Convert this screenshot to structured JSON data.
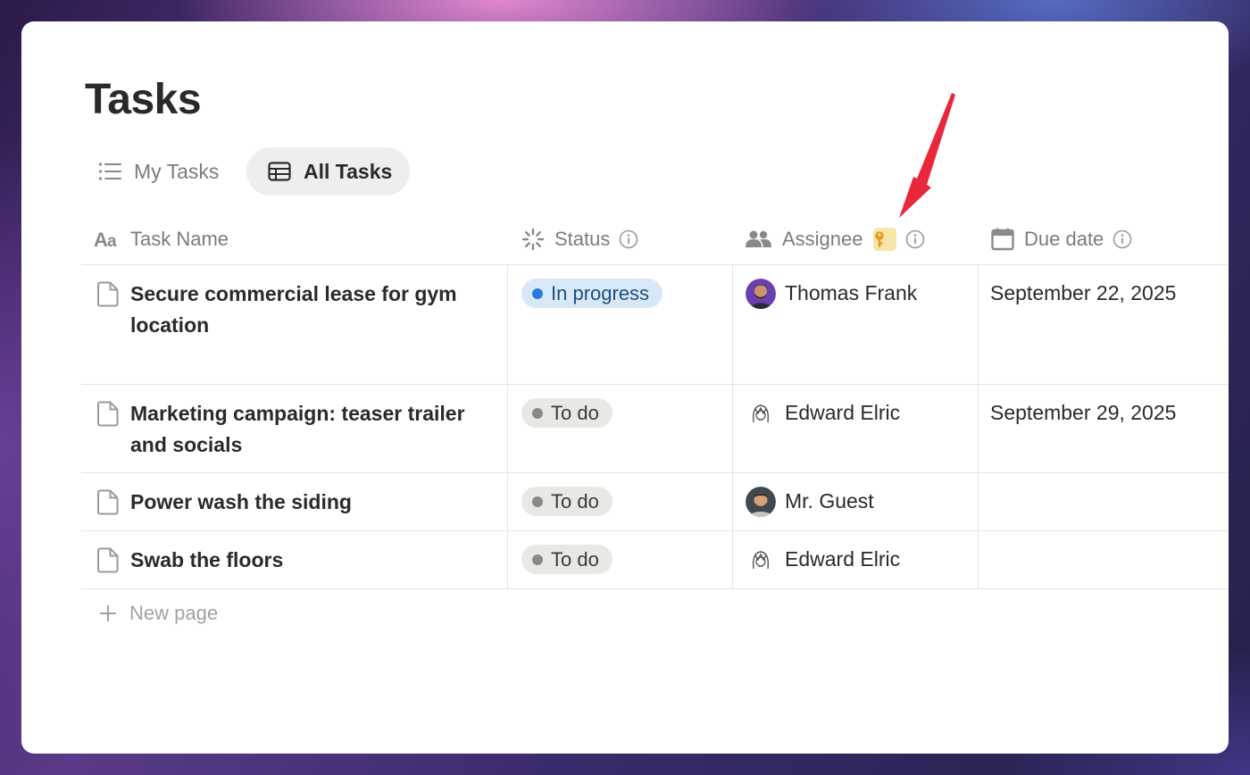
{
  "page": {
    "title": "Tasks"
  },
  "views": [
    {
      "label": "My Tasks",
      "icon": "list-icon",
      "active": false
    },
    {
      "label": "All Tasks",
      "icon": "table-icon",
      "active": true
    }
  ],
  "columns": [
    {
      "label": "Task Name",
      "icon": "text-property-icon"
    },
    {
      "label": "Status",
      "icon": "status-spinner-icon"
    },
    {
      "label": "Assignee",
      "icon": "people-icon",
      "badge_icon": "key-icon"
    },
    {
      "label": "Due date",
      "icon": "calendar-icon"
    }
  ],
  "rows": [
    {
      "name": "Secure commercial lease for gym location",
      "status": "In progress",
      "assignee": "Thomas Frank",
      "due": "September 22, 2025"
    },
    {
      "name": "Marketing campaign: teaser trailer and socials",
      "status": "To do",
      "assignee": "Edward Elric",
      "due": "September 29, 2025"
    },
    {
      "name": "Power wash the siding",
      "status": "To do",
      "assignee": "Mr. Guest",
      "due": ""
    },
    {
      "name": "Swab the floors",
      "status": "To do",
      "assignee": "Edward Elric",
      "due": ""
    }
  ],
  "new_page": {
    "label": "New page"
  },
  "colors": {
    "in_progress_bg": "#d9e8f7",
    "in_progress_dot": "#2a7bd6",
    "todo_bg": "#e9e8e5",
    "todo_dot": "#8a8985",
    "key_badge_bg": "#f6e6a8",
    "annotation_arrow": "#e8283a"
  }
}
